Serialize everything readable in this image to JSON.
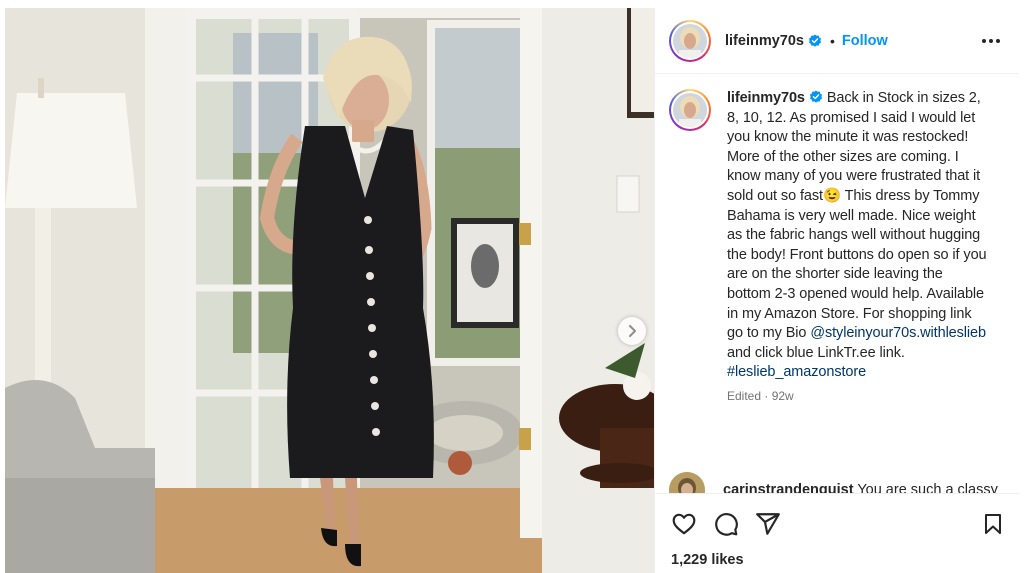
{
  "post": {
    "username": "lifeinmy70s",
    "follow_label": "Follow",
    "dot": "•"
  },
  "caption": {
    "username": "lifeinmy70s",
    "text": "Back in Stock in sizes 2, 8, 10, 12. As promised I said I would let you know the minute it was restocked! More of the other sizes are coming. I know many of you were frustrated that it sold out so fast",
    "emoji": "😉",
    "text2": "This dress by Tommy Bahama is very well made. Nice weight as the fabric hangs well without hugging the body! Front buttons do open so if you are on the shorter side leaving the bottom 2-3 opened would help. Available in my Amazon Store. For shopping link go to my Bio",
    "mention": "@styleinyour70s.withleslieb",
    "text3": "and click blue LinkTr.ee link.",
    "hashtag": "#leslieb_amazonstore",
    "meta": "Edited · 92w"
  },
  "comment": {
    "username": "carinstrandenquist",
    "text": "You are such a classy"
  },
  "stats": {
    "likes": "1,229 likes"
  },
  "icons": {
    "verified": "verified-badge-icon",
    "more": "more-options-icon",
    "like": "heart-icon",
    "comment": "comment-icon",
    "share": "share-icon",
    "save": "bookmark-icon",
    "next": "chevron-right-icon"
  },
  "colors": {
    "link_blue": "#0095f6",
    "mention_blue": "#00376b",
    "verified_blue": "#0095f6",
    "meta_gray": "#737373"
  }
}
